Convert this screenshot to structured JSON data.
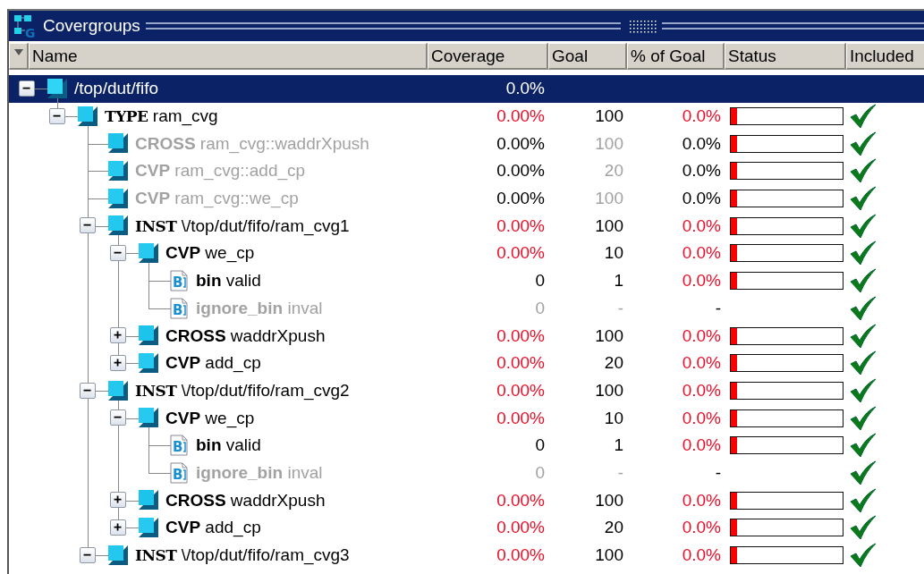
{
  "window": {
    "title": "Covergroups",
    "icon_letter": "G"
  },
  "columns": [
    "Name",
    "Coverage",
    "Goal",
    "% of Goal",
    "Status",
    "Included"
  ],
  "tree": [
    {
      "kind": "scope",
      "name": "/top/dut/fifo",
      "selected": true,
      "expanded": true,
      "disabled": false,
      "coverage": "0.0%",
      "coverage_alert": false,
      "included": false,
      "children": [
        {
          "kind": "type",
          "keyword": "TYPE",
          "name": "ram_cvg",
          "selected": false,
          "expanded": true,
          "disabled": false,
          "coverage": "0.00%",
          "coverage_alert": true,
          "goal": "100",
          "percent": "0.0%",
          "percent_alert": true,
          "level": 0,
          "included": true,
          "children": [
            {
              "kind": "cross",
              "keyword": "CROSS",
              "name": "ram_cvg::waddrXpush",
              "selected": false,
              "disabled": true,
              "coverage": "0.00%",
              "coverage_alert": false,
              "goal": "100",
              "percent": "0.0%",
              "percent_alert": false,
              "level": 0,
              "included": true
            },
            {
              "kind": "cvp",
              "keyword": "CVP",
              "name": "ram_cvg::add_cp",
              "selected": false,
              "disabled": true,
              "coverage": "0.00%",
              "coverage_alert": false,
              "goal": "20",
              "percent": "0.0%",
              "percent_alert": false,
              "level": 0,
              "included": true
            },
            {
              "kind": "cvp",
              "keyword": "CVP",
              "name": "ram_cvg::we_cp",
              "selected": false,
              "disabled": true,
              "coverage": "0.00%",
              "coverage_alert": false,
              "goal": "100",
              "percent": "0.0%",
              "percent_alert": false,
              "level": 0,
              "included": true
            },
            {
              "kind": "inst",
              "keyword": "INST",
              "name": "\\/top/dut/fifo/ram_cvg1",
              "selected": false,
              "expanded": true,
              "disabled": false,
              "coverage": "0.00%",
              "coverage_alert": true,
              "goal": "100",
              "percent": "0.0%",
              "percent_alert": true,
              "level": 0,
              "included": true,
              "children": [
                {
                  "kind": "cvp",
                  "keyword": "CVP",
                  "name": "we_cp",
                  "selected": false,
                  "expanded": true,
                  "disabled": false,
                  "coverage": "0.00%",
                  "coverage_alert": true,
                  "goal": "10",
                  "percent": "0.0%",
                  "percent_alert": true,
                  "level": 0,
                  "included": true,
                  "children": [
                    {
                      "kind": "bin",
                      "icon_letter": "B",
                      "keyword": "bin",
                      "name": "valid",
                      "selected": false,
                      "disabled": false,
                      "coverage": "0",
                      "coverage_alert": false,
                      "goal": "1",
                      "percent": "0.0%",
                      "percent_alert": true,
                      "level": 0,
                      "included": true
                    },
                    {
                      "kind": "ignore_bin",
                      "icon_letter": "B",
                      "keyword": "ignore_bin",
                      "name": "inval",
                      "selected": false,
                      "disabled": true,
                      "coverage": "0",
                      "coverage_alert": false,
                      "goal": "-",
                      "percent": "-",
                      "percent_alert": false,
                      "included": true
                    }
                  ]
                },
                {
                  "kind": "cross",
                  "keyword": "CROSS",
                  "name": "waddrXpush",
                  "selected": false,
                  "expanded": false,
                  "disabled": false,
                  "coverage": "0.00%",
                  "coverage_alert": true,
                  "goal": "100",
                  "percent": "0.0%",
                  "percent_alert": true,
                  "level": 0,
                  "included": true
                },
                {
                  "kind": "cvp",
                  "keyword": "CVP",
                  "name": "add_cp",
                  "selected": false,
                  "expanded": false,
                  "disabled": false,
                  "coverage": "0.00%",
                  "coverage_alert": true,
                  "goal": "20",
                  "percent": "0.0%",
                  "percent_alert": true,
                  "level": 0,
                  "included": true
                }
              ]
            },
            {
              "kind": "inst",
              "keyword": "INST",
              "name": "\\/top/dut/fifo/ram_cvg2",
              "selected": false,
              "expanded": true,
              "disabled": false,
              "coverage": "0.00%",
              "coverage_alert": true,
              "goal": "100",
              "percent": "0.0%",
              "percent_alert": true,
              "level": 0,
              "included": true,
              "children": [
                {
                  "kind": "cvp",
                  "keyword": "CVP",
                  "name": "we_cp",
                  "selected": false,
                  "expanded": true,
                  "disabled": false,
                  "coverage": "0.00%",
                  "coverage_alert": true,
                  "goal": "10",
                  "percent": "0.0%",
                  "percent_alert": true,
                  "level": 0,
                  "included": true,
                  "children": [
                    {
                      "kind": "bin",
                      "icon_letter": "B",
                      "keyword": "bin",
                      "name": "valid",
                      "selected": false,
                      "disabled": false,
                      "coverage": "0",
                      "coverage_alert": false,
                      "goal": "1",
                      "percent": "0.0%",
                      "percent_alert": true,
                      "level": 0,
                      "included": true
                    },
                    {
                      "kind": "ignore_bin",
                      "icon_letter": "B",
                      "keyword": "ignore_bin",
                      "name": "inval",
                      "selected": false,
                      "disabled": true,
                      "coverage": "0",
                      "coverage_alert": false,
                      "goal": "-",
                      "percent": "-",
                      "percent_alert": false,
                      "included": true
                    }
                  ]
                },
                {
                  "kind": "cross",
                  "keyword": "CROSS",
                  "name": "waddrXpush",
                  "selected": false,
                  "expanded": false,
                  "disabled": false,
                  "coverage": "0.00%",
                  "coverage_alert": true,
                  "goal": "100",
                  "percent": "0.0%",
                  "percent_alert": true,
                  "level": 0,
                  "included": true
                },
                {
                  "kind": "cvp",
                  "keyword": "CVP",
                  "name": "add_cp",
                  "selected": false,
                  "expanded": false,
                  "disabled": false,
                  "coverage": "0.00%",
                  "coverage_alert": true,
                  "goal": "20",
                  "percent": "0.0%",
                  "percent_alert": true,
                  "level": 0,
                  "included": true
                }
              ]
            },
            {
              "kind": "inst",
              "keyword": "INST",
              "name": "\\/top/dut/fifo/ram_cvg3",
              "selected": false,
              "expanded": true,
              "disabled": false,
              "coverage": "0.00%",
              "coverage_alert": true,
              "goal": "100",
              "percent": "0.0%",
              "percent_alert": true,
              "level": 0,
              "included": true
            }
          ]
        }
      ]
    }
  ]
}
